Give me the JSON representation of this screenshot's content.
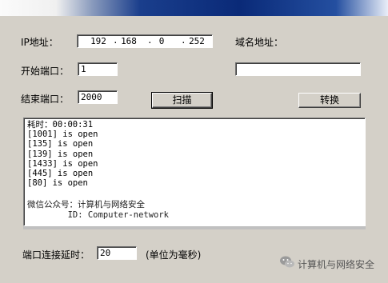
{
  "window": {
    "title_bar_colors": [
      "#fbfbfb",
      "#0a2a78",
      "#e9eef8"
    ]
  },
  "form": {
    "ip_label": "IP地址：",
    "ip_octets": [
      "192",
      "168",
      "0",
      "252"
    ],
    "domain_label": "域名地址：",
    "domain_value": "",
    "start_port_label": "开始端口：",
    "start_port_value": "1",
    "end_port_label": "结束端口：",
    "end_port_value": "2000",
    "scan_button": "扫描",
    "convert_button": "转换",
    "delay_label": "端口连接延时：",
    "delay_value": "20",
    "delay_unit": "(单位为毫秒)"
  },
  "log": {
    "lines": [
      "耗时：00:00:31",
      "[1001] is open",
      "[135] is open",
      "[139] is open",
      "[1433] is open",
      "[445] is open",
      "[80] is open"
    ],
    "info_lines": [
      "微信公众号：计算机与网络安全",
      "        ID: Computer-network"
    ]
  },
  "watermark": {
    "text": "计算机与网络安全",
    "icon": "wechat-icon"
  }
}
